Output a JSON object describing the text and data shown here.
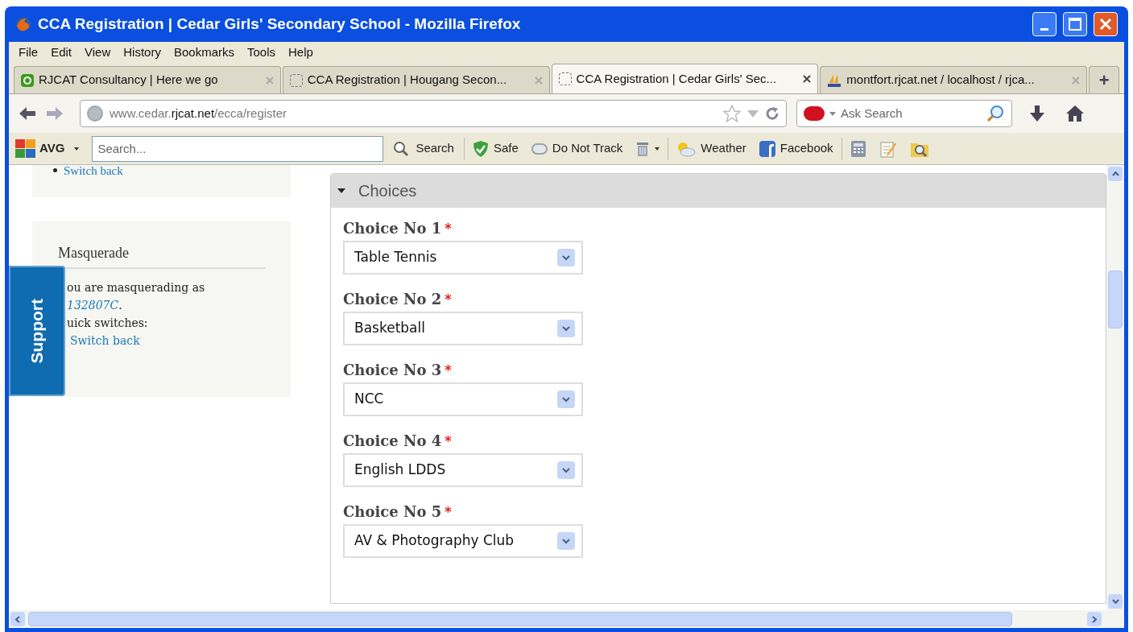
{
  "window": {
    "title": "CCA Registration | Cedar Girls' Secondary School - Mozilla Firefox"
  },
  "menu": [
    {
      "label": "File"
    },
    {
      "label": "Edit"
    },
    {
      "label": "View"
    },
    {
      "label": "History"
    },
    {
      "label": "Bookmarks"
    },
    {
      "label": "Tools"
    },
    {
      "label": "Help"
    }
  ],
  "tabs": [
    {
      "kind": "leaf",
      "label": "RJCAT Consultancy | Here we go",
      "selected": false
    },
    {
      "kind": "blank",
      "label": "CCA Registration | Hougang Secon...",
      "selected": false
    },
    {
      "kind": "blank",
      "label": "CCA Registration | Cedar Girls' Sec...",
      "selected": true
    },
    {
      "kind": "pma",
      "label": "montfort.rjcat.net / localhost / rjca...",
      "selected": false
    }
  ],
  "new_tab": "+",
  "address": {
    "prefix": "www.cedar.",
    "domain": "rjcat.net",
    "path": "/ecca/register"
  },
  "web_search": {
    "placeholder": "Ask Search"
  },
  "toolbar": {
    "brand": "AVG",
    "search_placeholder": "Search...",
    "search_button": "Search",
    "items": [
      {
        "kind": "safe",
        "label": "Safe"
      },
      {
        "kind": "track",
        "label": "Do Not Track"
      },
      {
        "kind": "trash"
      },
      {
        "kind": "weather",
        "label": "Weather"
      },
      {
        "kind": "facebook",
        "label": "Facebook"
      },
      {
        "kind": "calculator"
      },
      {
        "kind": "notepad"
      },
      {
        "kind": "finder"
      }
    ]
  },
  "sidebar": {
    "top_link": "Switch back",
    "masquerade": {
      "title": "Masquerade",
      "text": "ou are masquerading as",
      "user": "132807C",
      "end": ".",
      "switches": "uick switches:",
      "link": "Switch back"
    }
  },
  "support_tab": "Support",
  "fieldset": {
    "legend": "Choices",
    "expanded": true,
    "required_mark": "*",
    "fields": [
      {
        "label": "Choice No 1",
        "required": true,
        "value": "Table Tennis"
      },
      {
        "label": "Choice No 2",
        "required": true,
        "value": "Basketball"
      },
      {
        "label": "Choice No 3",
        "required": true,
        "value": "NCC"
      },
      {
        "label": "Choice No 4",
        "required": true,
        "value": "English LDDS"
      },
      {
        "label": "Choice No 5",
        "required": true,
        "value": "AV & Photography Club"
      }
    ]
  }
}
